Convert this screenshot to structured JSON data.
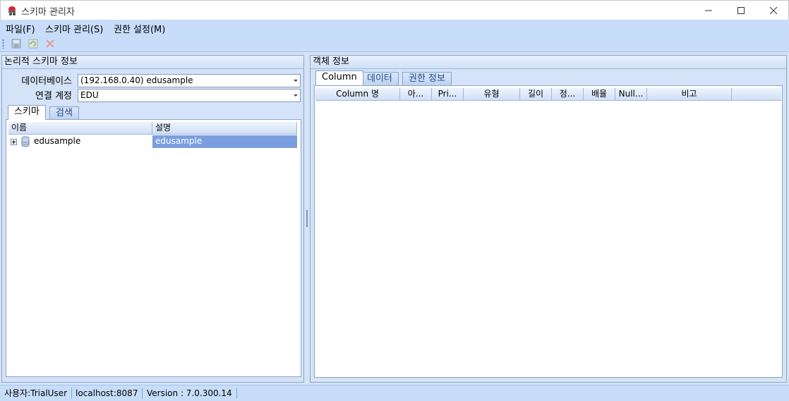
{
  "window": {
    "title": "스키마 관리자"
  },
  "menu": [
    "파일(F)",
    "스키마 관리(S)",
    "권한 설정(M)"
  ],
  "toolbar": {
    "icons": [
      "save-icon",
      "refresh-icon",
      "delete-icon"
    ]
  },
  "left": {
    "header": "논리적 스키마 정보",
    "database_label": "데이터베이스",
    "database_value": "(192.168.0.40) edusample",
    "account_label": "연결 계정",
    "account_value": "EDU",
    "tabs": [
      "스키마",
      "검색"
    ],
    "grid_headers": [
      "이름",
      "설명"
    ],
    "rows": [
      {
        "name": "edusample",
        "description": "edusample"
      }
    ]
  },
  "right": {
    "header": "객체 정보",
    "tabs": [
      "Column",
      "데이터",
      "권한 정보"
    ],
    "columns": [
      "Column 명",
      "아...",
      "Pri...",
      "유형",
      "길이",
      "정...",
      "배율",
      "Null...",
      "비고"
    ]
  },
  "status": {
    "user": "사용자:TrialUser",
    "host": "localhost:8087",
    "version": "Version : 7.0.300.14"
  },
  "colors": {
    "accent": "#c7ddf9",
    "selection": "#7b9ee0"
  }
}
